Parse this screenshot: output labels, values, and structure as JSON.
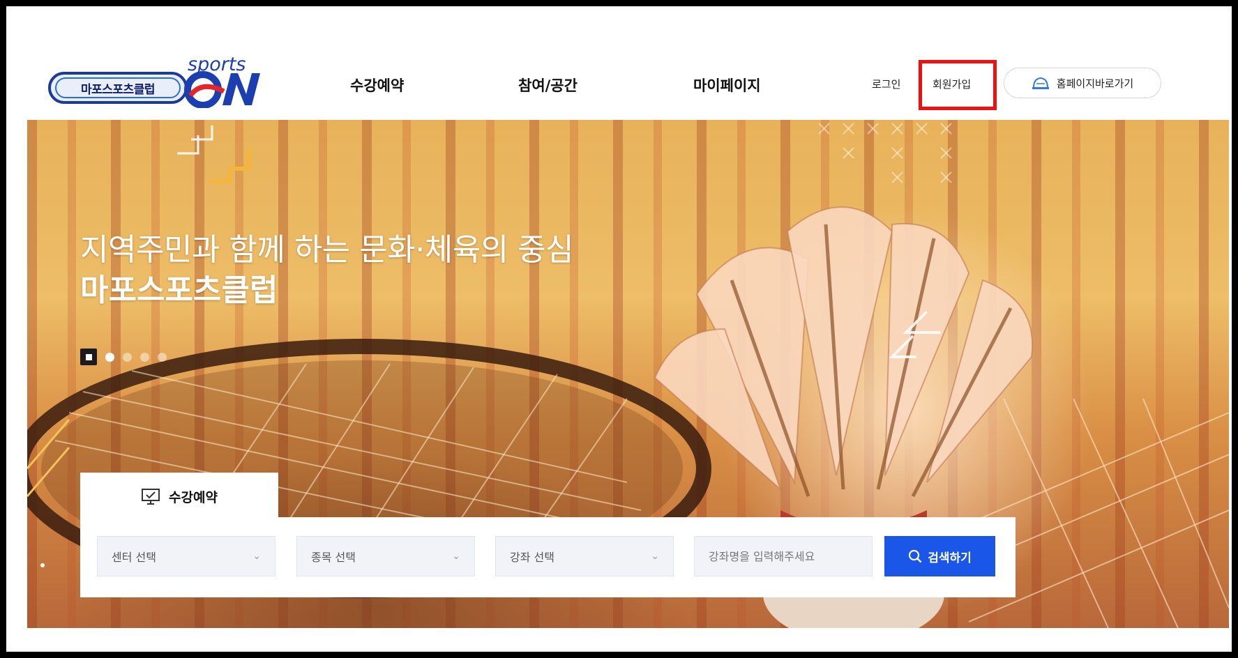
{
  "brand": {
    "badge_text": "마포스포츠클럽",
    "sports_text": "sports",
    "on_text": "ON"
  },
  "nav": {
    "items": [
      {
        "label": "수강예약"
      },
      {
        "label": "참여/공간"
      },
      {
        "label": "마이페이지"
      }
    ]
  },
  "top_links": {
    "login": "로그인",
    "signup": "회원가입",
    "homepage": "홈페이지바로가기"
  },
  "hero": {
    "line1": "지역주민과 함께 하는 문화·체육의 중심",
    "line2": "마포스포츠클럽",
    "slide_count": 4,
    "active_slide": 1
  },
  "search": {
    "tab_label": "수강예약",
    "selects": [
      {
        "label": "센터 선택"
      },
      {
        "label": "종목 선택"
      },
      {
        "label": "강좌 선택"
      }
    ],
    "keyword_placeholder": "강좌명을 입력해주세요",
    "button_label": "검색하기"
  },
  "colors": {
    "primary": "#1a56e8",
    "highlight_box": "#ee1111",
    "brand_navy": "#1a3aa0"
  }
}
